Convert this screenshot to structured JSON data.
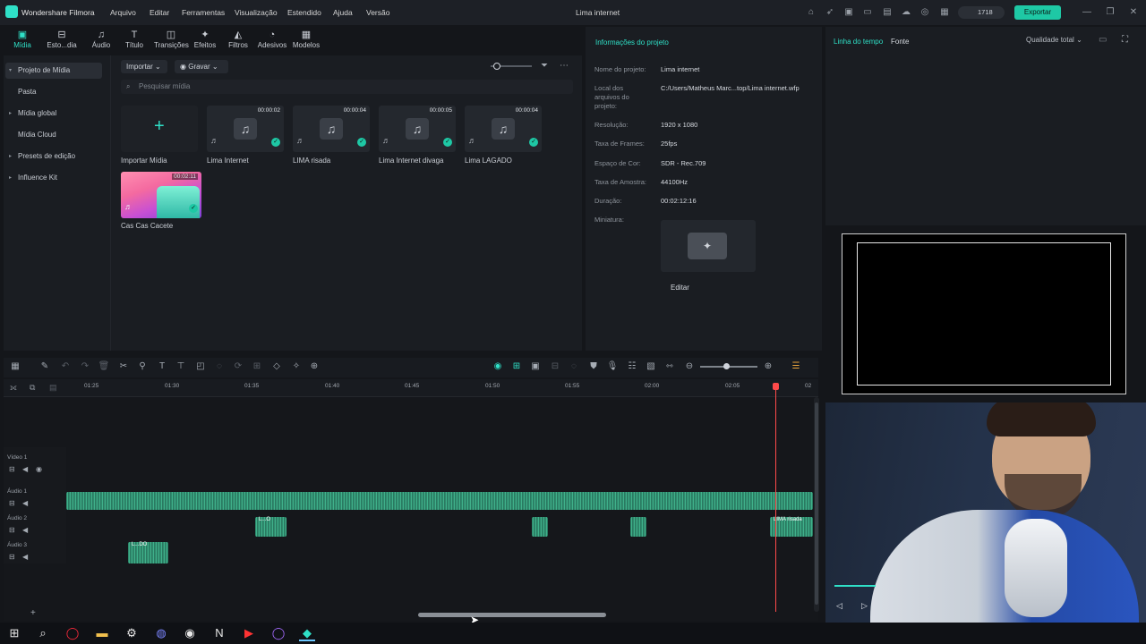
{
  "app": {
    "name": "Wondershare Filmora",
    "project_title": "Lima internet"
  },
  "menu": [
    "Arquivo",
    "Editar",
    "Ferramentas",
    "Visualização",
    "Estendido",
    "Ajuda",
    "Versão"
  ],
  "credits": "1718",
  "export_label": "Exportar",
  "toolbar": [
    {
      "label": "Mídia",
      "icon": "media-icon"
    },
    {
      "label": "Esto...dia",
      "icon": "stock-media-icon"
    },
    {
      "label": "Áudio",
      "icon": "audio-note-icon"
    },
    {
      "label": "Título",
      "icon": "title-t-icon"
    },
    {
      "label": "Transições",
      "icon": "transition-icon"
    },
    {
      "label": "Efeitos",
      "icon": "effects-icon"
    },
    {
      "label": "Filtros",
      "icon": "filters-icon"
    },
    {
      "label": "Adesivos",
      "icon": "stickers-icon"
    },
    {
      "label": "Modelos",
      "icon": "templates-icon"
    }
  ],
  "sidebar": [
    {
      "label": "Projeto de Mídia",
      "arrow": "▾"
    },
    {
      "label": "Pasta",
      "arrow": ""
    },
    {
      "label": "Mídia global",
      "arrow": "▸"
    },
    {
      "label": "Mídia Cloud",
      "arrow": ""
    },
    {
      "label": "Presets de edição",
      "arrow": "▸"
    },
    {
      "label": "Influence Kit",
      "arrow": "▸"
    }
  ],
  "media_toolbar": {
    "import": "Importar",
    "record": "Gravar",
    "search_placeholder": "Pesquisar mídia"
  },
  "media_items": [
    {
      "name": "Importar Mídia",
      "duration": ""
    },
    {
      "name": "Lima Internet",
      "duration": "00:00:02"
    },
    {
      "name": "LIMA risada",
      "duration": "00:00:04"
    },
    {
      "name": "Lima Internet divaga",
      "duration": "00:00:05"
    },
    {
      "name": "Lima LAGADO",
      "duration": "00:00:04"
    },
    {
      "name": "Cas Cas Cacete",
      "duration": "00:02:11"
    }
  ],
  "project_info": {
    "heading": "Informações do projeto",
    "rows": [
      {
        "key": "Nome do projeto:",
        "value": "Lima internet"
      },
      {
        "key": "Local dos arquivos do projeto:",
        "value": "C:/Users/Matheus Marc...top/Lima internet.wfp"
      },
      {
        "key": "Resolução:",
        "value": "1920 x 1080"
      },
      {
        "key": "Taxa de Frames:",
        "value": "25fps"
      },
      {
        "key": "Espaço de Cor:",
        "value": "SDR - Rec.709"
      },
      {
        "key": "Taxa de Amostra:",
        "value": "44100Hz"
      },
      {
        "key": "Duração:",
        "value": "00:02:12:16"
      },
      {
        "key": "Miniatura:",
        "value": ""
      }
    ],
    "edit_label": "Editar"
  },
  "right_tabs": {
    "timeline": "Linha do tempo",
    "font": "Fonte",
    "quality": "Qualidade total"
  },
  "ruler": [
    "01:25",
    "01:30",
    "01:35",
    "01:40",
    "01:45",
    "01:50",
    "01:55",
    "02:00",
    "02:05",
    "02"
  ],
  "tracks": [
    {
      "label": "Vídeo 1"
    },
    {
      "label": "Áudio 1"
    },
    {
      "label": "Áudio 2"
    },
    {
      "label": "Áudio 3"
    }
  ],
  "clip_labels": {
    "a2_last": "LIMA risada",
    "a2_small": "L...O",
    "a3_small": "L...DO"
  },
  "colors": {
    "accent": "#1ec8a5",
    "playhead": "#ff4a4a",
    "wave": "#3fb08a"
  }
}
